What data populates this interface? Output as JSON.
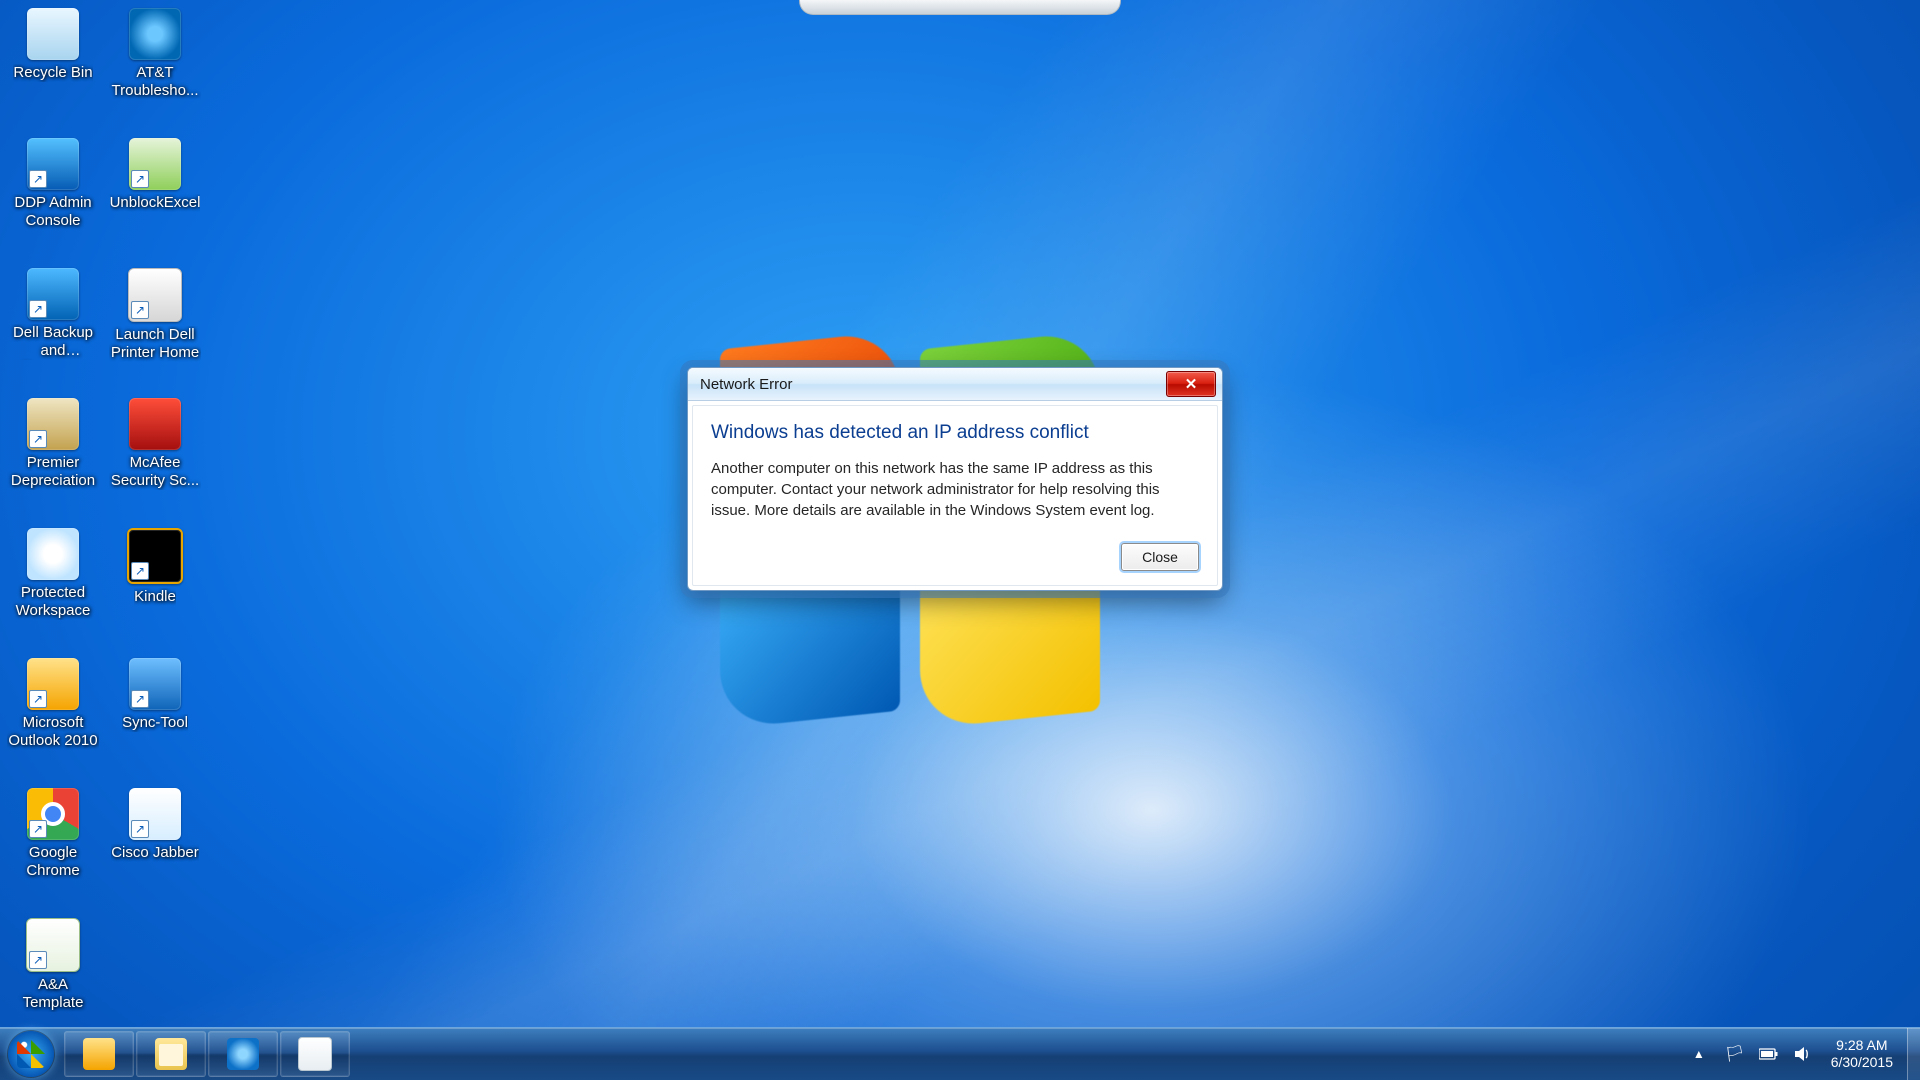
{
  "desktop_icons": [
    {
      "name": "recycle-bin",
      "label": "Recycle Bin",
      "glyph": "g-bin",
      "shortcut": false
    },
    {
      "name": "ddp-admin-console",
      "label": "DDP Admin Console",
      "glyph": "g-ddp",
      "shortcut": true
    },
    {
      "name": "dell-backup-recovery",
      "label": "Dell Backup and Recovery",
      "glyph": "g-dellbk",
      "shortcut": true
    },
    {
      "name": "premier-depreciation",
      "label": "Premier Depreciation",
      "glyph": "g-premier",
      "shortcut": true
    },
    {
      "name": "protected-workspace",
      "label": "Protected Workspace",
      "glyph": "g-protws",
      "shortcut": false
    },
    {
      "name": "microsoft-outlook",
      "label": "Microsoft Outlook 2010",
      "glyph": "g-outlook",
      "shortcut": true
    },
    {
      "name": "google-chrome",
      "label": "Google Chrome",
      "glyph": "g-chrome",
      "shortcut": true
    },
    {
      "name": "aa-template",
      "label": "A&A Template",
      "glyph": "g-excel",
      "shortcut": true
    },
    {
      "name": "att-troubleshoot",
      "label": "AT&T Troublesho...",
      "glyph": "g-att",
      "shortcut": false
    },
    {
      "name": "unblock-excel",
      "label": "UnblockExcel",
      "glyph": "g-unblock",
      "shortcut": true
    },
    {
      "name": "launch-dell-printer",
      "label": "Launch Dell Printer Home",
      "glyph": "g-printer",
      "shortcut": true
    },
    {
      "name": "mcafee-security",
      "label": "McAfee Security Sc...",
      "glyph": "g-mcafee",
      "shortcut": false
    },
    {
      "name": "kindle",
      "label": "Kindle",
      "glyph": "g-kindle",
      "shortcut": true
    },
    {
      "name": "sync-tool",
      "label": "Sync-Tool",
      "glyph": "g-sync",
      "shortcut": true
    },
    {
      "name": "cisco-jabber",
      "label": "Cisco Jabber",
      "glyph": "g-cisco",
      "shortcut": true
    }
  ],
  "dialog": {
    "title": "Network Error",
    "heading": "Windows has detected an IP address conflict",
    "body": "Another computer on this network has the same IP address as this computer. Contact your network administrator for help resolving this issue. More details are available in the Windows System event log.",
    "close_button": "Close"
  },
  "taskbar": {
    "pinned": [
      {
        "name": "outlook",
        "icon": "ic-outlook"
      },
      {
        "name": "file-explorer",
        "icon": "ic-explorer"
      },
      {
        "name": "internet-explorer",
        "icon": "ic-ie"
      },
      {
        "name": "notepad",
        "icon": "ic-notepad"
      }
    ],
    "tray": {
      "time": "9:28 AM",
      "date": "6/30/2015"
    }
  }
}
